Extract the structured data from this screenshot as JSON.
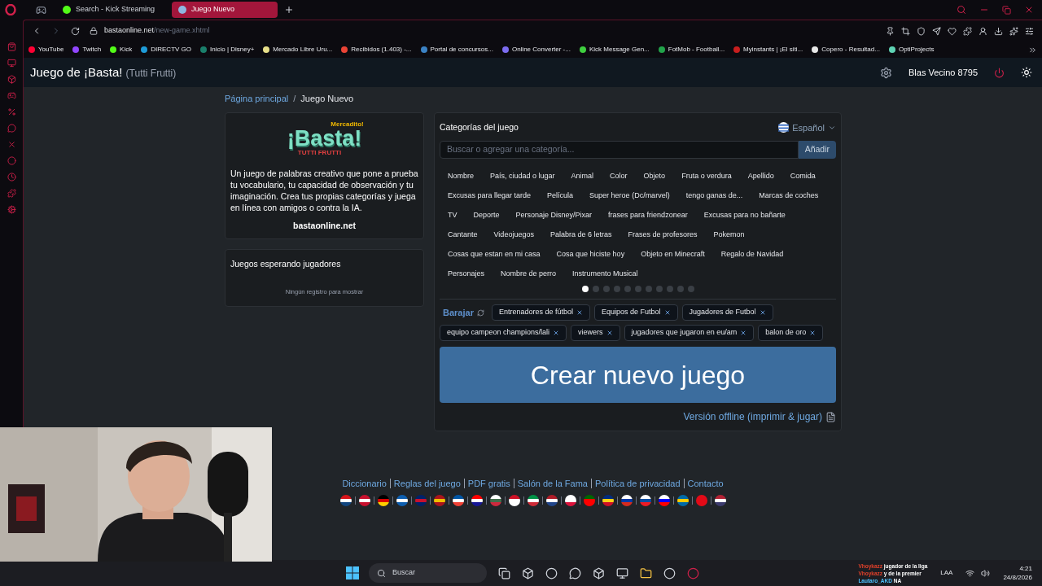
{
  "browser": {
    "tabs": [
      {
        "title": "Search - Kick Streaming",
        "selected": false,
        "color": "#53fc18"
      },
      {
        "title": "Juego Nuevo",
        "selected": true,
        "color": "#8fb6e0"
      }
    ],
    "url_host": "bastaonline.net",
    "url_path": "/new-game.xhtml",
    "bookmarks": [
      {
        "label": "YouTube",
        "color": "#ff0033"
      },
      {
        "label": "Twitch",
        "color": "#9146ff"
      },
      {
        "label": "Kick",
        "color": "#53fc18"
      },
      {
        "label": "DIRECTV GO",
        "color": "#1e9bd7"
      },
      {
        "label": "Inicio | Disney+",
        "color": "#1a7f6b"
      },
      {
        "label": "Mercado Libre Uru...",
        "color": "#e8e08a"
      },
      {
        "label": "Recibidos (1.403) -...",
        "color": "#ea4335"
      },
      {
        "label": "Portal de concursos...",
        "color": "#3b82c4"
      },
      {
        "label": "Online Converter -...",
        "color": "#7c6cf0"
      },
      {
        "label": "Kick Message Gen...",
        "color": "#3fcf3f"
      },
      {
        "label": "FotMob - Football...",
        "color": "#22a34a"
      },
      {
        "label": "Myinstants | ¡El siti...",
        "color": "#c81e1e"
      },
      {
        "label": "Copero - Resultad...",
        "color": "#e8e8e8"
      },
      {
        "label": "OptiProjects",
        "color": "#5fd3b4"
      }
    ]
  },
  "header": {
    "title": "Juego de ¡Basta!",
    "subtitle": "(Tutti Frutti)",
    "user": "Blas Vecino 8795"
  },
  "breadcrumb": [
    {
      "label": "Página principal",
      "selected": false
    },
    {
      "label": "Juego Nuevo",
      "selected": true
    }
  ],
  "breadcrumb_separator": "/",
  "intro_card": {
    "logo_top": "Mercadito!",
    "logo_main": "¡Basta!",
    "logo_bottom": "TUTTI FRUTTI",
    "description": "Un juego de palabras creativo que pone a prueba tu vocabulario, tu capacidad de observación y tu imaginación. Crea tus propias categorías y juega en línea con amigos o contra la IA.",
    "site": "bastaonline.net"
  },
  "waiting_card": {
    "title": "Juegos esperando jugadores",
    "empty": "Ningún registro para mostrar"
  },
  "categories_panel": {
    "title": "Categorías del juego",
    "language": "Español",
    "search_placeholder": "Buscar o agregar una categoría...",
    "add_button": "Añadir",
    "categories": [
      "Nombre",
      "País, ciudad o lugar",
      "Animal",
      "Color",
      "Objeto",
      "Fruta o verdura",
      "Apellido",
      "Comida",
      "Excusas para llegar tarde",
      "Película",
      "Super heroe (Dc/marvel)",
      "tengo ganas de...",
      "Marcas de coches",
      "TV",
      "Deporte",
      "Personaje Disney/Pixar",
      "frases para friendzonear",
      "Excusas para no bañarte",
      "Cantante",
      "Videojuegos",
      "Palabra de 6 letras",
      "Frases de profesores",
      "Pokemon",
      "Cosas que estan en mi casa",
      "Cosa que hiciste hoy",
      "Objeto en Minecraft",
      "Regalo de Navidad",
      "Personajes",
      "Nombre de perro",
      "Instrumento Musical"
    ],
    "pages": [
      {
        "selected": true
      },
      {
        "selected": false
      },
      {
        "selected": false
      },
      {
        "selected": false
      },
      {
        "selected": false
      },
      {
        "selected": false
      },
      {
        "selected": false
      },
      {
        "selected": false
      },
      {
        "selected": false
      },
      {
        "selected": false
      },
      {
        "selected": false
      }
    ],
    "shuffle": "Barajar",
    "chosen": [
      "Entrenadores de fútbol",
      "Equipos de Futbol",
      "Jugadores de Futbol",
      "equipo campeon champions/lali",
      "viewers",
      "jugadores que jugaron en eu/am",
      "balon de oro"
    ],
    "create_button": "Crear nuevo juego",
    "offline_link": "Versión offline (imprimir & jugar)"
  },
  "footer_links": [
    "Diccionario",
    "Reglas del juego",
    "PDF gratis",
    "Salón de la Fama",
    "Política de privacidad",
    "Contacto"
  ],
  "taskbar": {
    "search_placeholder": "Buscar",
    "chat": [
      {
        "user": "Vhoykazz",
        "text": "jugador de la liga"
      },
      {
        "user": "Vhoykazz",
        "text": "y de la premier"
      },
      {
        "user": "Lautaro_AKD",
        "text": "NA"
      }
    ],
    "keyboard": "LAA",
    "time": "4:21",
    "date": "24/8/2026"
  },
  "webcam": {
    "kind": "picture"
  }
}
